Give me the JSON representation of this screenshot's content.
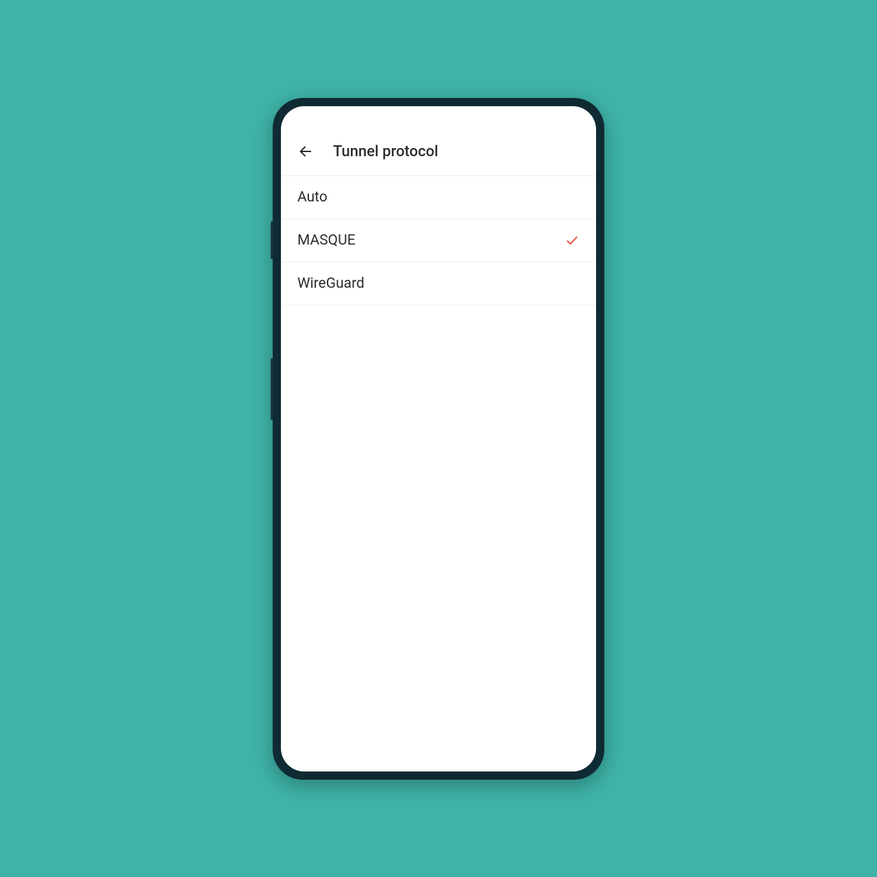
{
  "header": {
    "title": "Tunnel protocol"
  },
  "options": [
    {
      "label": "Auto",
      "selected": false
    },
    {
      "label": "MASQUE",
      "selected": true
    },
    {
      "label": "WireGuard",
      "selected": false
    }
  ],
  "colors": {
    "background": "#3fb3a8",
    "accent": "#e85e4a"
  }
}
